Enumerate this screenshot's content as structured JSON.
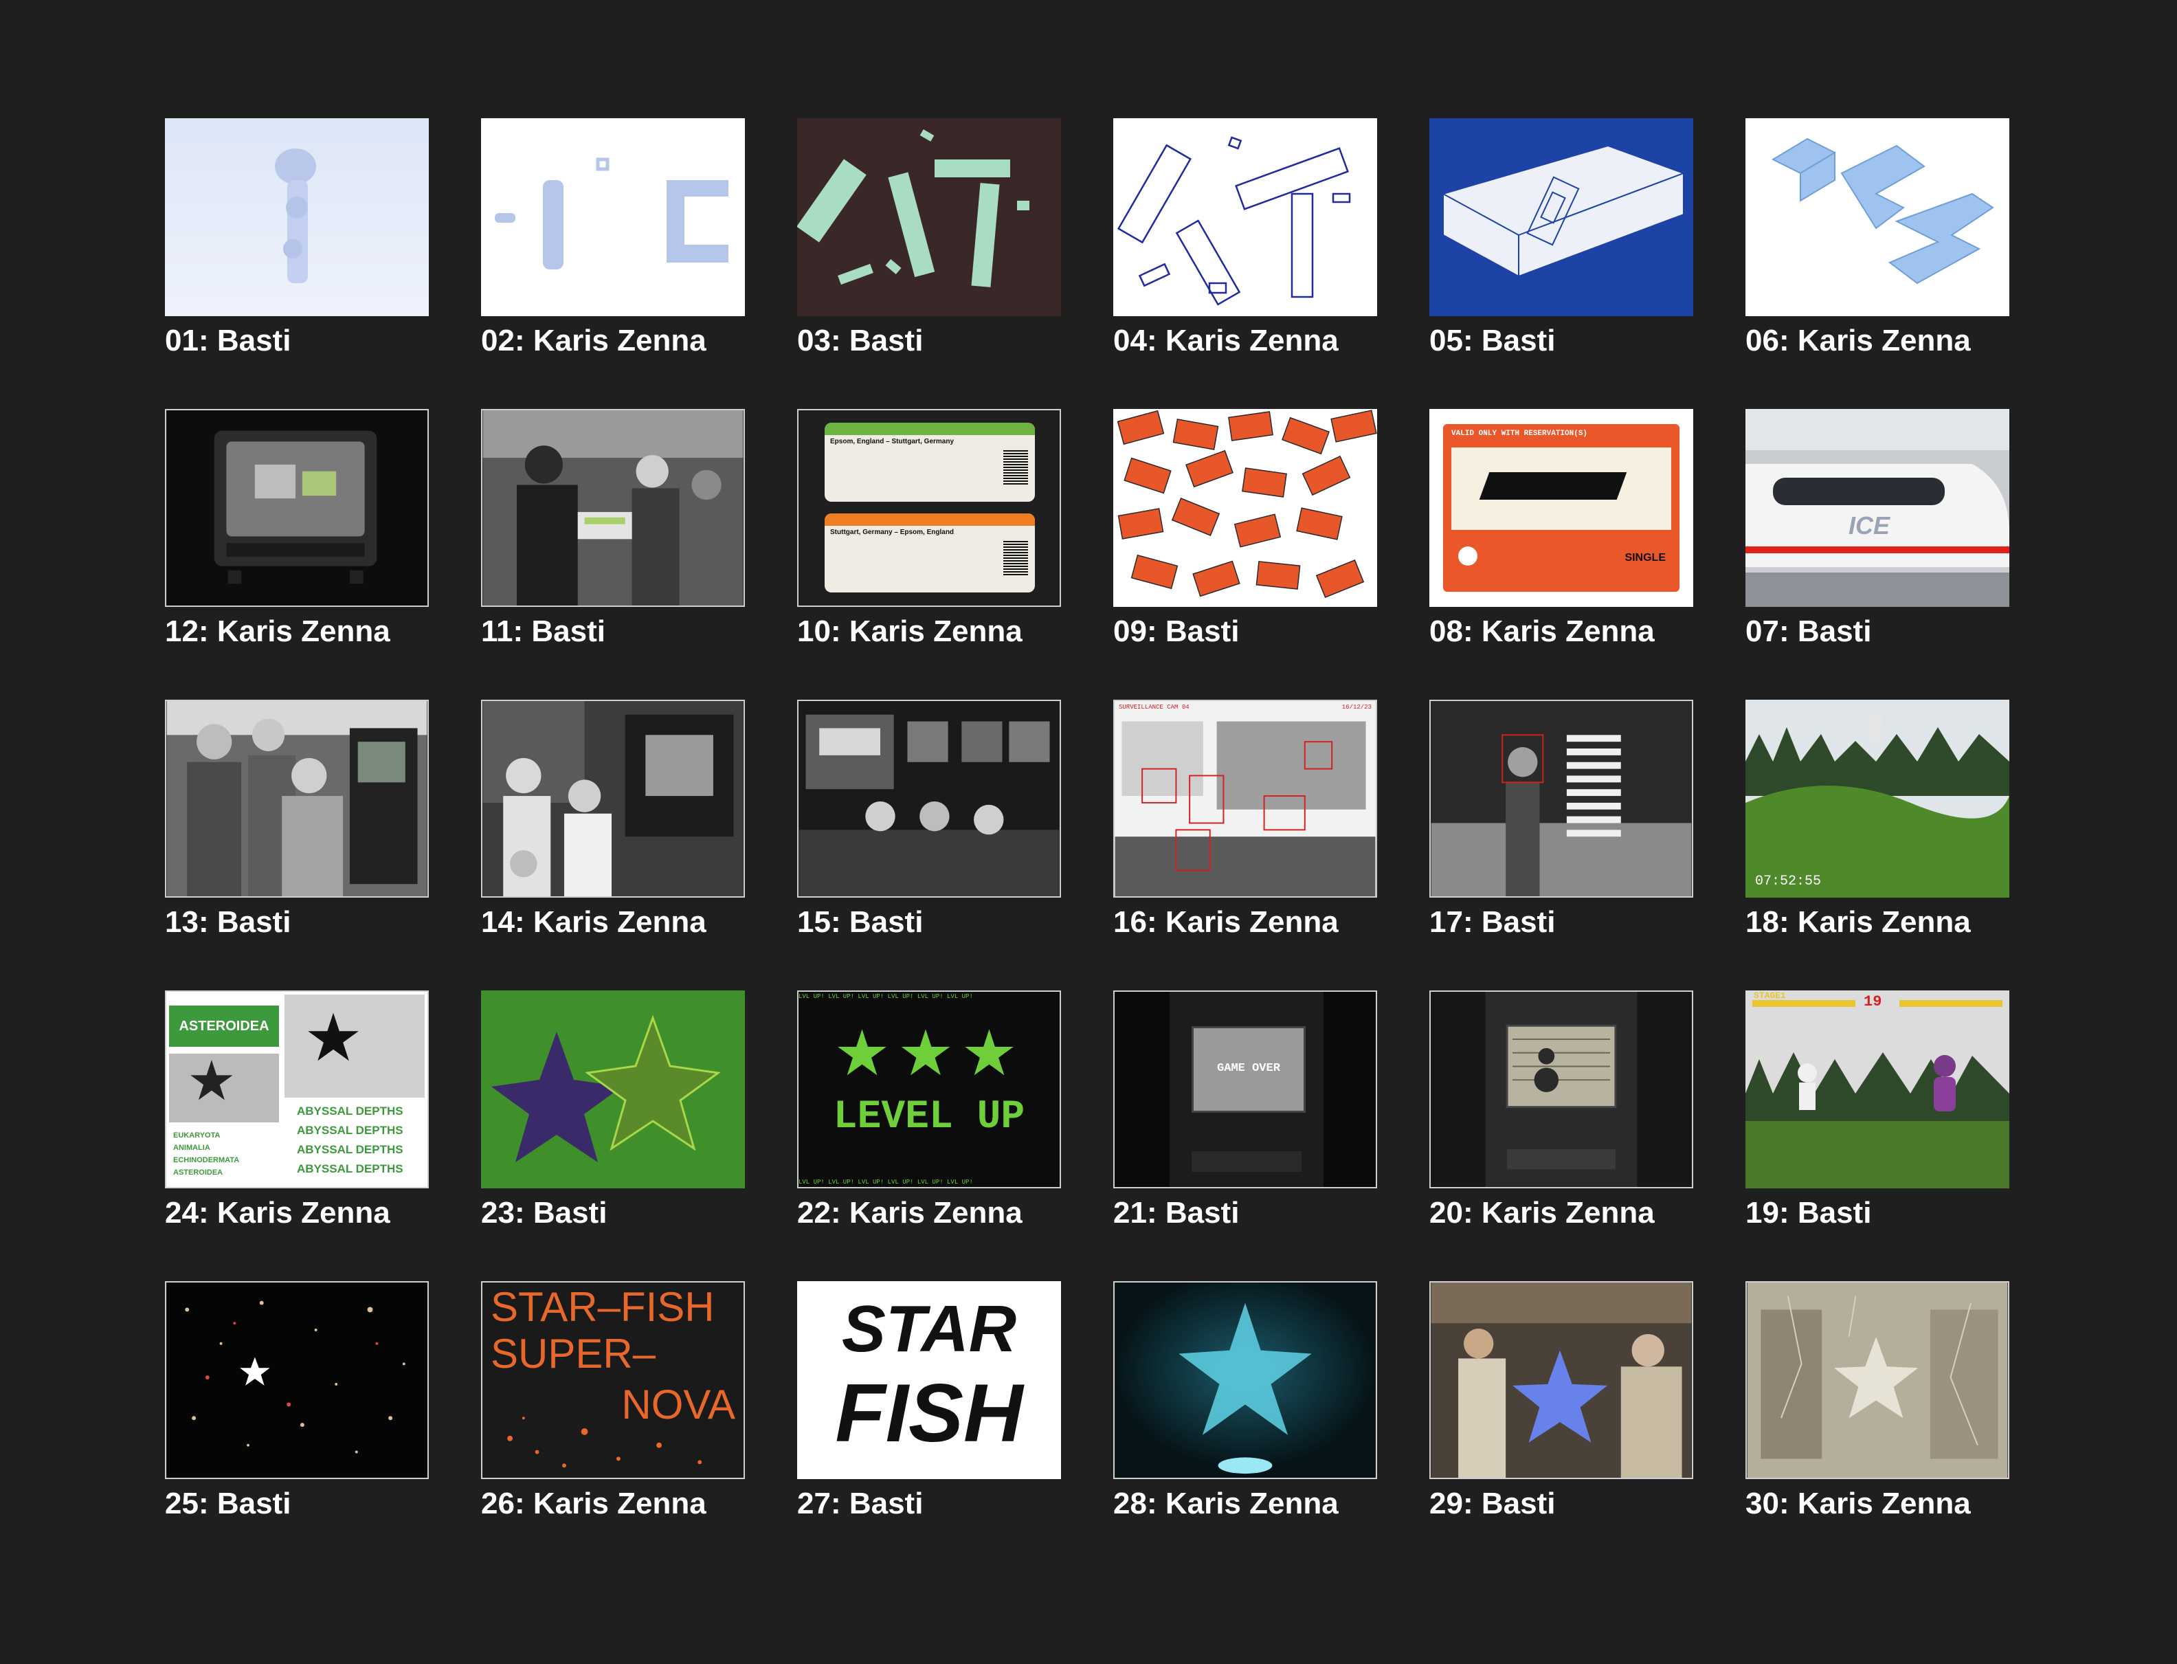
{
  "tiles": [
    {
      "caption": "01: Basti"
    },
    {
      "caption": "02: Karis Zenna"
    },
    {
      "caption": "03: Basti"
    },
    {
      "caption": "04: Karis Zenna"
    },
    {
      "caption": "05: Basti"
    },
    {
      "caption": "06: Karis Zenna"
    },
    {
      "caption": "12: Karis Zenna"
    },
    {
      "caption": "11: Basti"
    },
    {
      "caption": "10: Karis Zenna",
      "ticket1_title": "Epsom, England – Stuttgart, Germany",
      "ticket2_title": "Stuttgart, Germany – Epsom, England"
    },
    {
      "caption": "09: Basti"
    },
    {
      "caption": "08: Karis Zenna",
      "ticket_text": "VALID ONLY WITH RESERVATION(S)",
      "single": "SINGLE"
    },
    {
      "caption": "07: Basti",
      "train_label": "ICE"
    },
    {
      "caption": "13: Basti"
    },
    {
      "caption": "14: Karis Zenna"
    },
    {
      "caption": "15: Basti"
    },
    {
      "caption": "16: Karis Zenna",
      "header_left": "SURVEILLANCE CAM 04",
      "header_right": "16/12/23"
    },
    {
      "caption": "17: Basti"
    },
    {
      "caption": "18: Karis Zenna",
      "timestamp": "07:52:55"
    },
    {
      "caption": "24: Karis Zenna",
      "tag": "ASTEROIDEA",
      "repeat_text": "ABYSSAL DEPTHS",
      "taxonomy": [
        "EUKARYOTA",
        "ANIMALIA",
        "ECHINODERMATA",
        "ASTEROIDEA"
      ]
    },
    {
      "caption": "23: Basti"
    },
    {
      "caption": "22: Karis Zenna",
      "level_text": "LEVEL UP",
      "border_text": "LVL UP! LVL UP! LVL UP! LVL UP! LVL UP! LVL UP!"
    },
    {
      "caption": "21: Basti",
      "screen_text": "GAME OVER"
    },
    {
      "caption": "20: Karis Zenna"
    },
    {
      "caption": "19: Basti",
      "hud_left": "STAGE1",
      "hud_num": "19"
    },
    {
      "caption": "25: Basti"
    },
    {
      "caption": "26: Karis Zenna",
      "line1": "STAR–FISH",
      "line2": "SUPER–",
      "line3": "NOVA"
    },
    {
      "caption": "27: Basti",
      "word1": "STAR",
      "word2": "FISH"
    },
    {
      "caption": "28: Karis Zenna"
    },
    {
      "caption": "29: Basti"
    },
    {
      "caption": "30: Karis Zenna"
    }
  ]
}
